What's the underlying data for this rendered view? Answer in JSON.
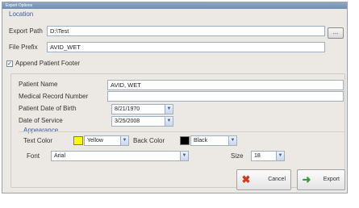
{
  "window": {
    "title": "Export Options"
  },
  "location": {
    "group_title": "Location",
    "export_path_label": "Export Path",
    "export_path_value": "D:\\Test",
    "browse_label": "...",
    "file_prefix_label": "File Prefix",
    "file_prefix_value": "AVID_WET"
  },
  "footer": {
    "append_checked": true,
    "check_glyph": "✓",
    "append_label": "Append Patient Footer"
  },
  "patient": {
    "name_label": "Patient Name",
    "name_value": "AVID, WET",
    "mrn_label": "Medical Record Number",
    "mrn_value": "",
    "dob_label": "Patient Date of Birth",
    "dob_value": "8/21/1970",
    "dos_label": "Date of Service",
    "dos_value": "3/25/2008"
  },
  "appearance": {
    "group_title": "Appearance",
    "text_color_label": "Text Color",
    "text_color_value": "Yellow",
    "text_color_hex": "#ffff00",
    "back_color_label": "Back Color",
    "back_color_value": "Black",
    "back_color_hex": "#000000",
    "font_label": "Font",
    "font_value": "Arial",
    "size_label": "Size",
    "size_value": "18"
  },
  "buttons": {
    "cancel_label": "Cancel",
    "cancel_icon": "✖",
    "export_label": "Export",
    "export_icon": "➜"
  },
  "combo_arrow": "▼"
}
